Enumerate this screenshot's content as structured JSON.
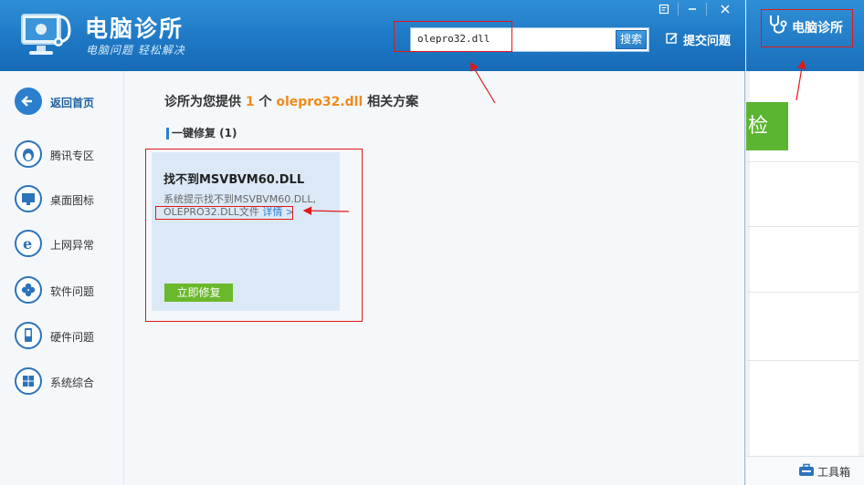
{
  "header": {
    "brand_title": "电脑诊所",
    "brand_subtitle": "电脑问题 轻松解决",
    "window_controls": [
      "feedback-icon",
      "minimize-icon",
      "close-icon"
    ],
    "search_value": "olepro32.dll",
    "search_button": "搜索",
    "submit_problem": "提交问题"
  },
  "sidebar": {
    "items": [
      {
        "label": "返回首页",
        "icon": "back-arrow-icon"
      },
      {
        "label": "腾讯专区",
        "icon": "qq-penguin-icon"
      },
      {
        "label": "桌面图标",
        "icon": "monitor-icon"
      },
      {
        "label": "上网异常",
        "icon": "ie-browser-icon"
      },
      {
        "label": "软件问题",
        "icon": "software-flower-icon"
      },
      {
        "label": "硬件问题",
        "icon": "hardware-phone-icon"
      },
      {
        "label": "系统综合",
        "icon": "windows-logo-icon"
      }
    ]
  },
  "content": {
    "headline_prefix": "诊所为您提供",
    "headline_count": "1",
    "headline_mid": "个",
    "headline_keyword": "olepro32.dll",
    "headline_suffix": "相关方案",
    "section_title": "一键修复 (1)",
    "card": {
      "title": "找不到MSVBVM60.DLL",
      "desc_line1": "系统提示找不到MSVBVM60.DLL,",
      "desc_line2": "OLEPRO32.DLL文件",
      "details_link": "详情 >",
      "fix_button": "立即修复"
    }
  },
  "right_panel": {
    "title": "电脑诊所",
    "green_button": "检",
    "toolbox": "工具箱"
  },
  "colors": {
    "header_blue": "#1e78c4",
    "accent_orange": "#f08a1c",
    "fix_green": "#6ab82b",
    "annotation_red": "#e21818"
  }
}
